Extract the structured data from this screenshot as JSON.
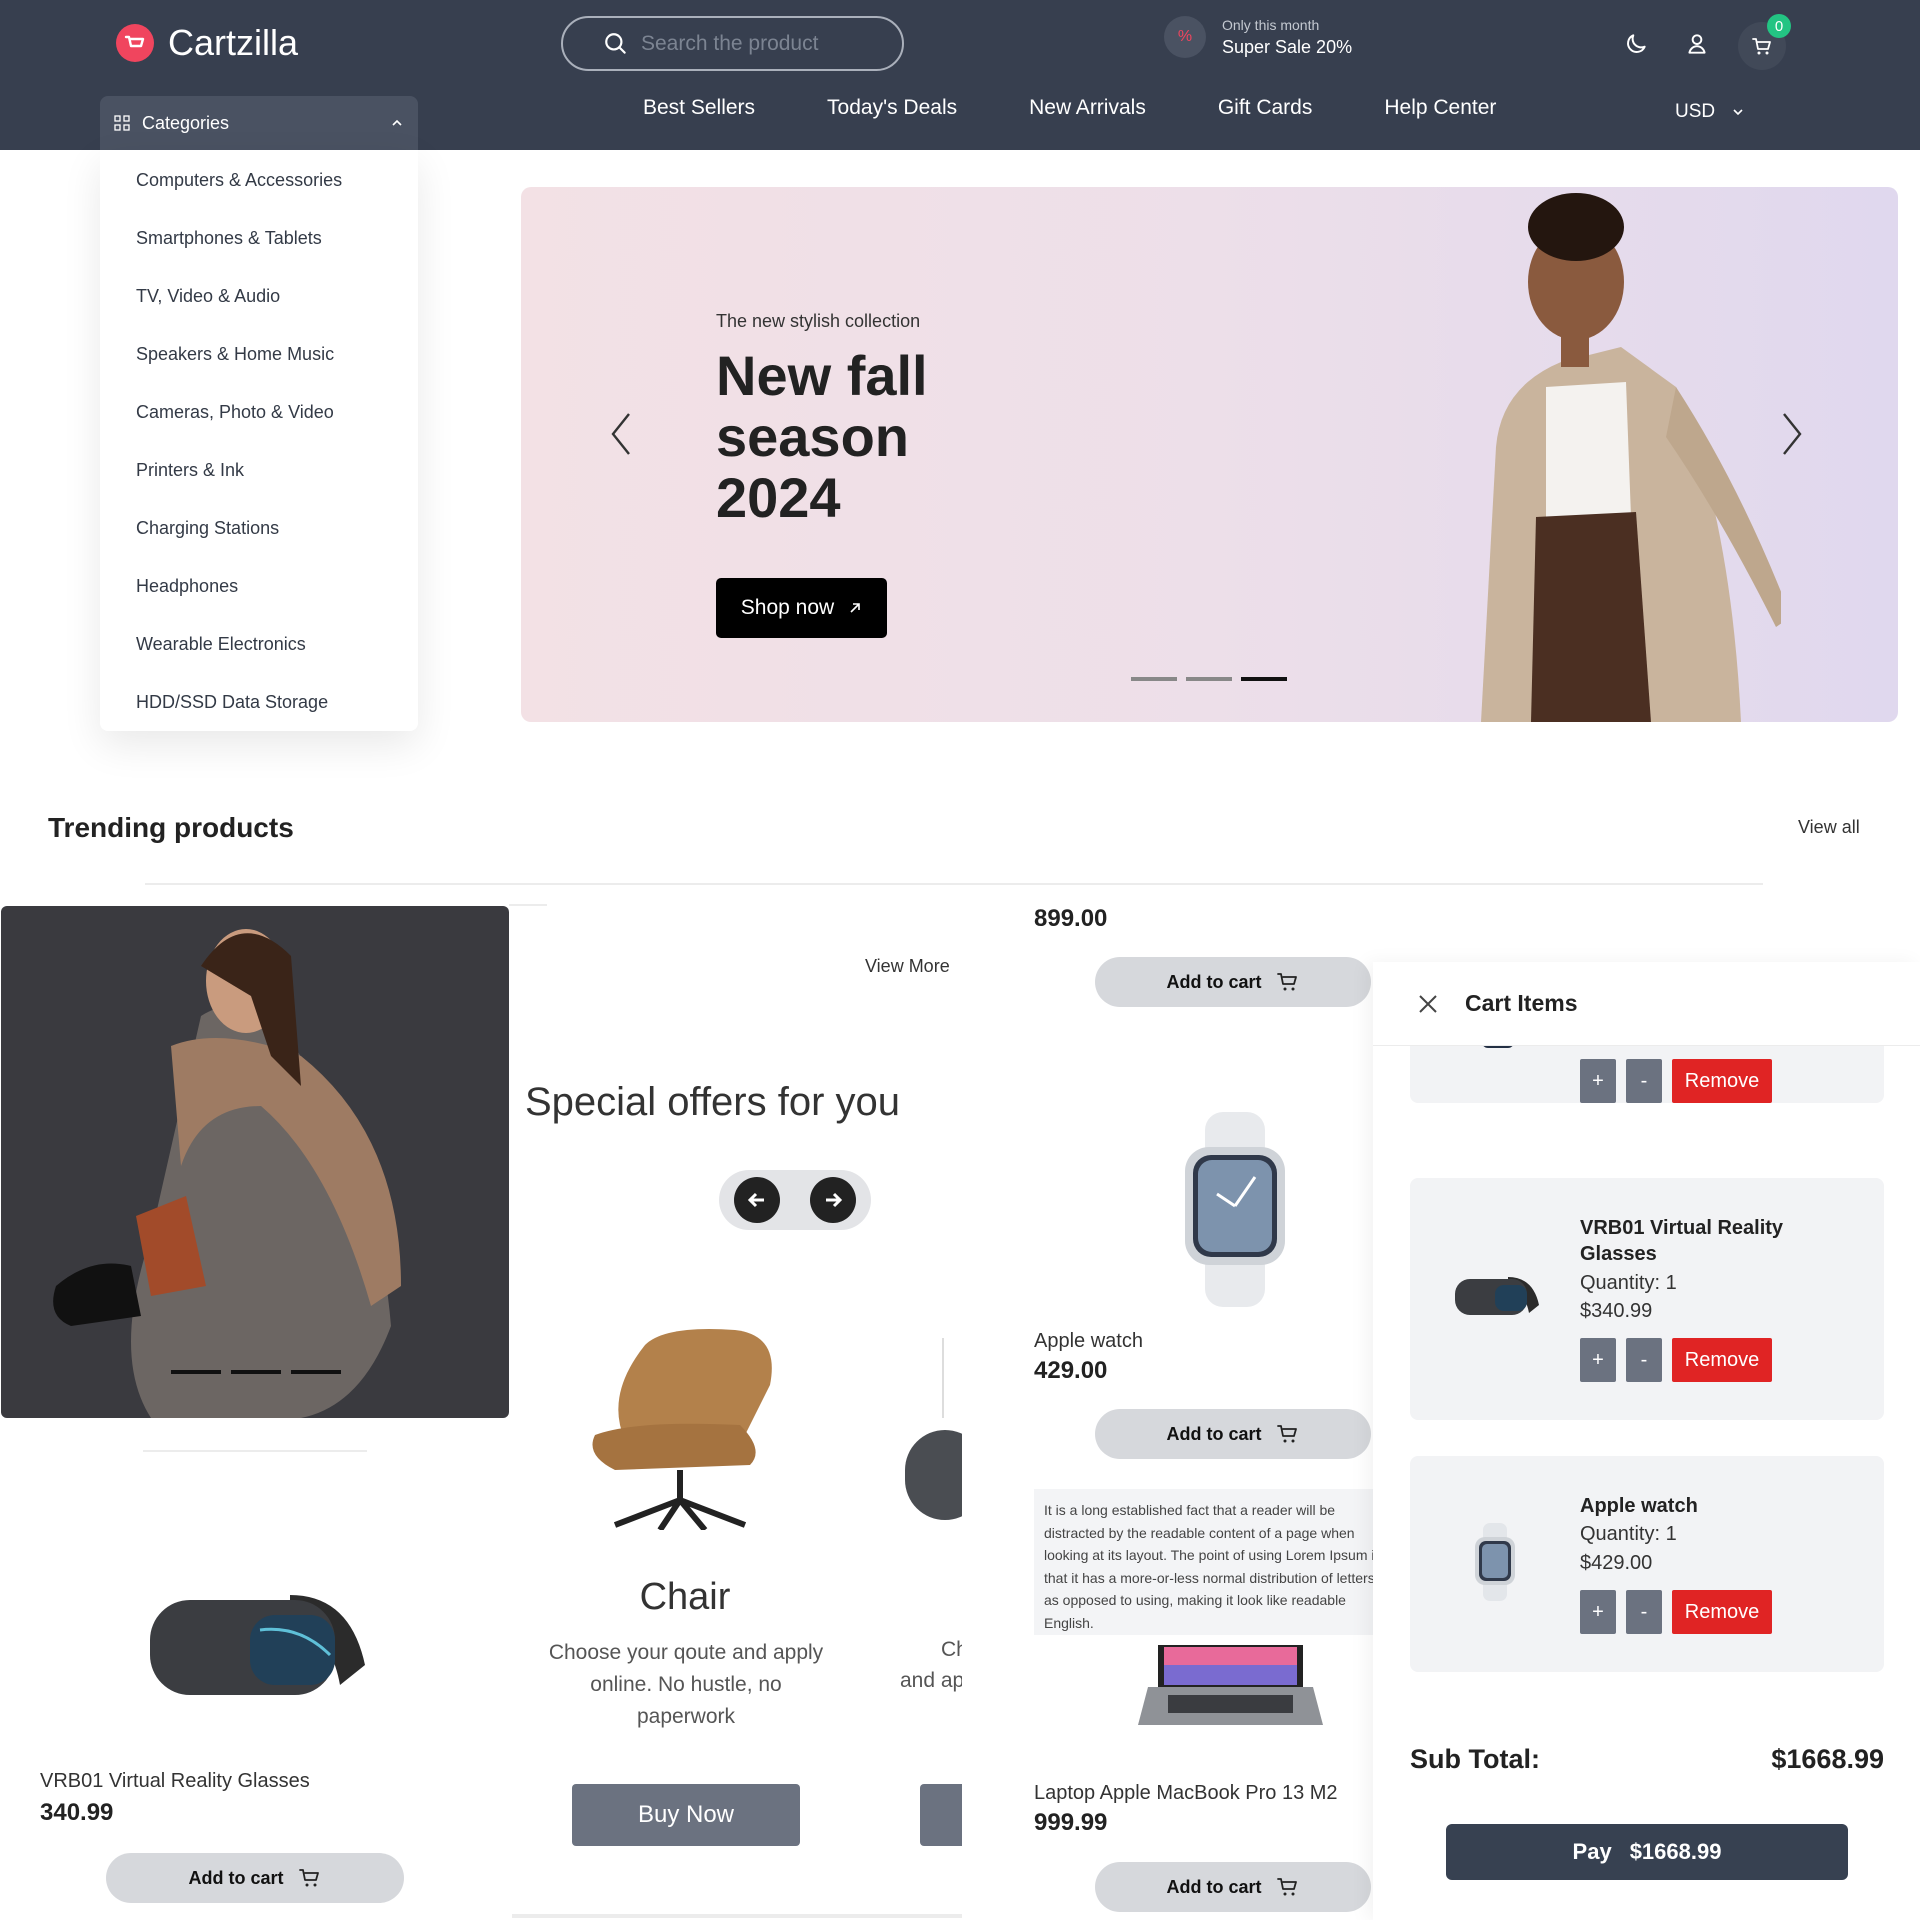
{
  "header": {
    "brand": "Cartzilla",
    "search_placeholder": "Search the product",
    "promo_small": "Only this month",
    "promo_big": "Super Sale 20%",
    "cart_count": "0",
    "categories_label": "Categories",
    "nav": [
      "Best Sellers",
      "Today's Deals",
      "New Arrivals",
      "Gift Cards",
      "Help Center"
    ],
    "currency": "USD"
  },
  "categories": [
    "Computers & Accessories",
    "Smartphones & Tablets",
    "TV, Video & Audio",
    "Speakers & Home Music",
    "Cameras, Photo & Video",
    "Printers & Ink",
    "Charging Stations",
    "Headphones",
    "Wearable Electronics",
    "HDD/SSD Data Storage"
  ],
  "hero": {
    "kicker": "The new stylish collection",
    "title": "New fall season 2024",
    "cta": "Shop now",
    "active_slide_index": 2
  },
  "trending": {
    "title": "Trending products",
    "view_all": "View all",
    "view_more": "View More",
    "add_to_cart": "Add to cart",
    "products": [
      {
        "name": "VRB01 Virtual Reality Glasses",
        "price": "340.99"
      },
      {
        "name": "",
        "price": "899.00"
      },
      {
        "name": "Apple watch",
        "price": "429.00"
      },
      {
        "name": "Laptop Apple MacBook Pro 13 M2",
        "price": "999.99"
      }
    ]
  },
  "special": {
    "title": "Special offers for you",
    "card_title": "Chair",
    "card_desc": "Choose your qoute and apply online. No hustle, no paperwork",
    "card_cta": "Buy Now",
    "peek_title": "Ch",
    "peek_desc": "and ap"
  },
  "tooltip_text": [
    "It is a long established fact that a reader will be",
    "distracted by the readable content of a page when",
    "looking at its layout. The point of using Lorem Ipsum is",
    "that it has a more-or-less normal distribution of letters,",
    "as opposed to using, making it look like readable",
    "English."
  ],
  "cart": {
    "title": "Cart Items",
    "plus": "+",
    "minus": "-",
    "remove": "Remove",
    "items": [
      {
        "name": "VRB01 Virtual Reality Glasses",
        "quantity": "Quantity: 1",
        "price": "$340.99"
      },
      {
        "name": "Apple watch",
        "quantity": "Quantity: 1",
        "price": "$429.00"
      }
    ],
    "subtotal_label": "Sub Total:",
    "subtotal_value": "$1668.99",
    "pay_label": "Pay",
    "pay_value": "$1668.99"
  }
}
